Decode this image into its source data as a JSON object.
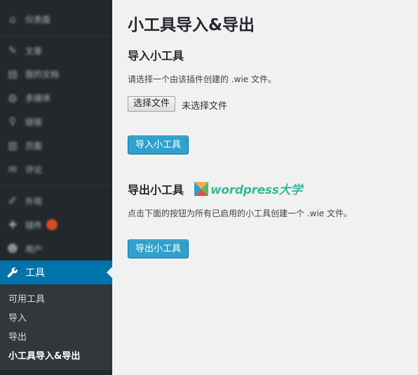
{
  "sidebar": {
    "blurred_items": [
      {
        "label": "仪表盘",
        "icon": "dashboard-icon",
        "glyph": "⌂"
      },
      {
        "label": "文章",
        "icon": "pin-icon",
        "glyph": "✎"
      },
      {
        "label": "我的文档",
        "icon": "document-icon",
        "glyph": "▤"
      },
      {
        "label": "多媒体",
        "icon": "media-icon",
        "glyph": "◍"
      },
      {
        "label": "链接",
        "icon": "link-icon",
        "glyph": "⚲"
      },
      {
        "label": "页面",
        "icon": "page-icon",
        "glyph": "▥"
      },
      {
        "label": "评论",
        "icon": "comment-icon",
        "glyph": "✉"
      },
      {
        "label": "外观",
        "icon": "appearance-icon",
        "glyph": "✐"
      },
      {
        "label": "插件",
        "icon": "plugin-icon",
        "glyph": "✚"
      },
      {
        "label": "用户",
        "icon": "users-icon",
        "glyph": "☻"
      }
    ],
    "active": {
      "label": "工具",
      "icon": "wrench-icon"
    },
    "submenu": [
      "可用工具",
      "导入",
      "导出",
      "小工具导入&导出"
    ]
  },
  "main": {
    "title": "小工具导入&导出",
    "import": {
      "heading": "导入小工具",
      "description": "请选择一个由该插件创建的 .wie 文件。",
      "file_button": "选择文件",
      "file_status": "未选择文件",
      "submit": "导入小工具"
    },
    "export": {
      "heading": "导出小工具",
      "watermark": "wordpress大学",
      "description": "点击下面的按钮为所有已启用的小工具创建一个 .wie 文件。",
      "submit": "导出小工具"
    }
  },
  "colors": {
    "sidebar_bg": "#23282d",
    "submenu_bg": "#32373c",
    "active_bg": "#0073aa",
    "button_bg": "#2ea2cc",
    "page_bg": "#f1f1f1",
    "logo_green": "#3bb79b"
  }
}
